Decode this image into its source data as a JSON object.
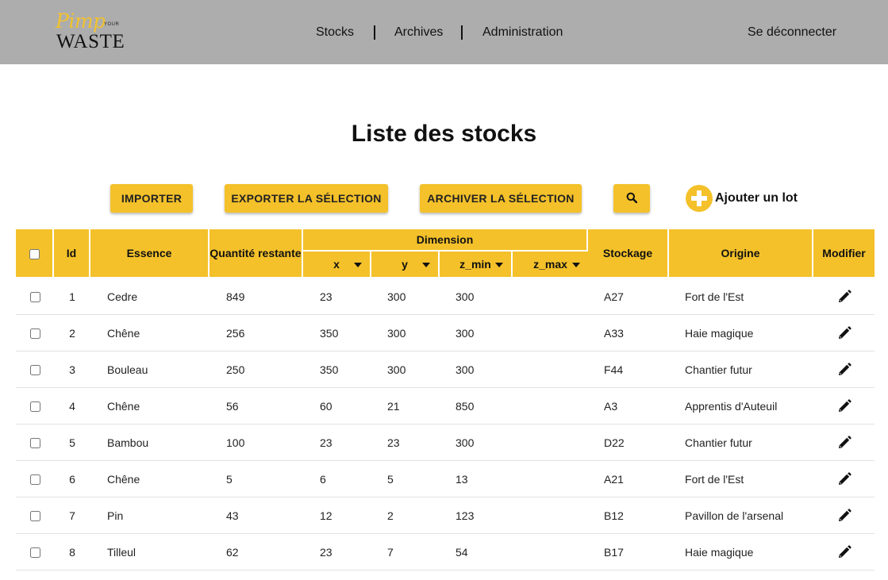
{
  "header": {
    "logo": {
      "script": "Pimp",
      "small": "YOUR",
      "main": "WASTE"
    },
    "nav": [
      "Stocks",
      "Archives",
      "Administration"
    ],
    "logout": "Se déconnecter"
  },
  "page": {
    "title": "Liste des stocks"
  },
  "toolbar": {
    "import_label": "IMPORTER",
    "export_label": "EXPORTER LA SÉLECTION",
    "archive_label": "ARCHIVER LA SÉLECTION",
    "search_icon": "search-icon",
    "add_label": "Ajouter un lot"
  },
  "table": {
    "headers": {
      "id": "Id",
      "essence": "Essence",
      "quantite": "Quantité restante",
      "dimension": "Dimension",
      "x": "x",
      "y": "y",
      "z_min": "z_min",
      "z_max": "z_max",
      "stockage": "Stockage",
      "origine": "Origine",
      "modifier": "Modifier"
    },
    "rows": [
      {
        "id": "1",
        "essence": "Cedre",
        "quantite": "849",
        "x": "23",
        "y": "300",
        "z_min": "300",
        "z_max": "",
        "stockage": "A27",
        "origine": "Fort de l'Est"
      },
      {
        "id": "2",
        "essence": "Chêne",
        "quantite": "256",
        "x": "350",
        "y": "300",
        "z_min": "300",
        "z_max": "",
        "stockage": "A33",
        "origine": "Haie magique"
      },
      {
        "id": "3",
        "essence": "Bouleau",
        "quantite": "250",
        "x": "350",
        "y": "300",
        "z_min": "300",
        "z_max": "",
        "stockage": "F44",
        "origine": "Chantier futur"
      },
      {
        "id": "4",
        "essence": "Chêne",
        "quantite": "56",
        "x": "60",
        "y": "21",
        "z_min": "850",
        "z_max": "",
        "stockage": "A3",
        "origine": "Apprentis d'Auteuil"
      },
      {
        "id": "5",
        "essence": "Bambou",
        "quantite": "100",
        "x": "23",
        "y": "23",
        "z_min": "300",
        "z_max": "",
        "stockage": "D22",
        "origine": "Chantier futur"
      },
      {
        "id": "6",
        "essence": "Chêne",
        "quantite": "5",
        "x": "6",
        "y": "5",
        "z_min": "13",
        "z_max": "",
        "stockage": "A21",
        "origine": "Fort de l'Est"
      },
      {
        "id": "7",
        "essence": "Pin",
        "quantite": "43",
        "x": "12",
        "y": "2",
        "z_min": "123",
        "z_max": "",
        "stockage": "B12",
        "origine": "Pavillon de l'arsenal"
      },
      {
        "id": "8",
        "essence": "Tilleul",
        "quantite": "62",
        "x": "23",
        "y": "7",
        "z_min": "54",
        "z_max": "",
        "stockage": "B17",
        "origine": "Haie magique"
      }
    ]
  },
  "colors": {
    "header_bg": "#adadad",
    "accent": "#f4c12a",
    "logo_script": "#f2c230"
  }
}
